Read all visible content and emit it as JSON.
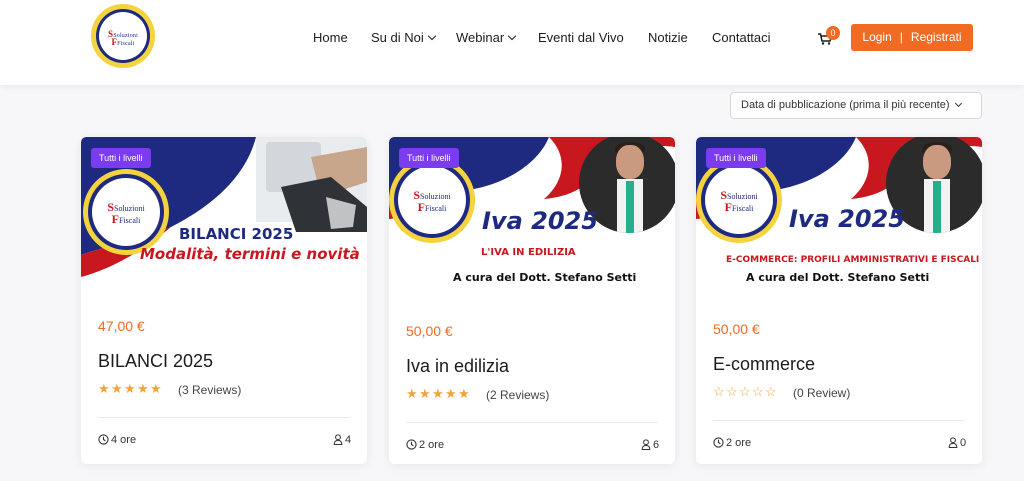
{
  "header": {
    "logo_text": [
      "Soluzioni",
      "Fiscali"
    ],
    "nav": [
      {
        "label": "Home",
        "has_dropdown": false
      },
      {
        "label": "Su di Noi",
        "has_dropdown": true
      },
      {
        "label": "Webinar",
        "has_dropdown": true
      },
      {
        "label": "Eventi dal Vivo",
        "has_dropdown": false
      },
      {
        "label": "Notizie",
        "has_dropdown": false
      },
      {
        "label": "Contattaci",
        "has_dropdown": false
      }
    ],
    "cart_count": "0",
    "login_label": "Login",
    "register_label": "Registrati",
    "separator": "|"
  },
  "sort": {
    "selected": "Data di pubblicazione (prima il più recente)"
  },
  "courses": [
    {
      "level": "Tutti i livelli",
      "thumb_lines": [
        "BILANCI 2025",
        "Modalità, termini e novità"
      ],
      "price": "47,00 €",
      "title": "BILANCI 2025",
      "rating": 5,
      "reviews": "(3 Reviews)",
      "duration": "4 ore",
      "students": "4"
    },
    {
      "level": "Tutti i livelli",
      "thumb_lines": [
        "Iva 2025",
        "L'IVA IN EDILIZIA",
        "A cura del Dott. Stefano Setti"
      ],
      "price": "50,00 €",
      "title": "Iva in edilizia",
      "rating": 5,
      "reviews": "(2 Reviews)",
      "duration": "2 ore",
      "students": "6"
    },
    {
      "level": "Tutti i livelli",
      "thumb_lines": [
        "Iva 2025",
        "E-COMMERCE: PROFILI AMMINISTRATIVI E FISCALI",
        "A cura del Dott. Stefano Setti"
      ],
      "price": "50,00 €",
      "title": "E-commerce",
      "rating": 0,
      "reviews": "(0 Review)",
      "duration": "2 ore",
      "students": "0"
    }
  ],
  "colors": {
    "accent": "#f26b22",
    "badge": "#7b3cf0",
    "star": "#f0a43a",
    "brand_blue": "#1e2a80",
    "brand_red": "#c8171e"
  }
}
